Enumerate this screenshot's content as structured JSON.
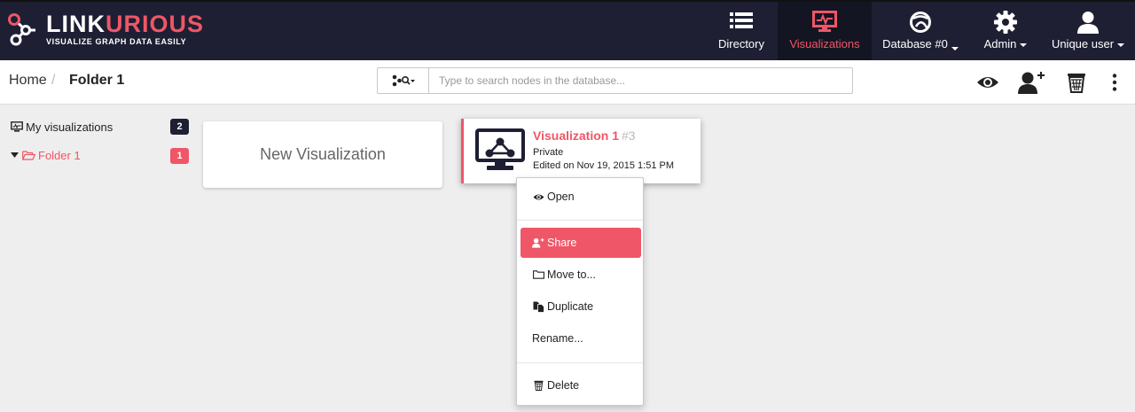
{
  "app": {
    "logo_part1": "LINK",
    "logo_part2": "URIOUS",
    "tagline": "VISUALIZE GRAPH DATA EASILY"
  },
  "nav": {
    "directory": "Directory",
    "visualizations": "Visualizations",
    "database": "Database #0",
    "admin": "Admin",
    "user": "Unique user"
  },
  "breadcrumb": {
    "home": "Home",
    "separator": "/",
    "current": "Folder 1"
  },
  "search": {
    "placeholder": "Type to search nodes in the database..."
  },
  "sidebar": {
    "items": [
      {
        "label": "My visualizations",
        "count": "2"
      },
      {
        "label": "Folder 1",
        "count": "1"
      }
    ]
  },
  "cards": {
    "new_label": "New Visualization",
    "viz": {
      "title": "Visualization 1",
      "id": "#3",
      "privacy": "Private",
      "edited": "Edited on Nov 19, 2015 1:51 PM"
    }
  },
  "menu": {
    "open": "Open",
    "share": "Share",
    "move": "Move to...",
    "duplicate": "Duplicate",
    "rename": "Rename...",
    "delete": "Delete"
  },
  "colors": {
    "topbar": "#1e1f33",
    "accent": "#ef5667",
    "dark_badge": "#1e1f33"
  }
}
